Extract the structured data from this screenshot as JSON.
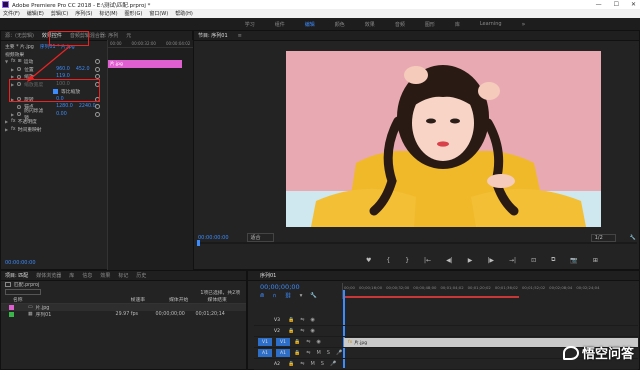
{
  "window": {
    "title": "Adobe Premiere Pro CC 2018 - E:\\测试\\匹配.prproj *",
    "minimize": "—",
    "maximize": "☐",
    "close": "✕"
  },
  "menu": [
    "文件(F)",
    "编辑(E)",
    "剪辑(C)",
    "序列(S)",
    "标记(M)",
    "图形(G)",
    "窗口(W)",
    "帮助(H)"
  ],
  "workspaces": {
    "items": [
      "学习",
      "组件",
      "编辑",
      "颜色",
      "效果",
      "音频",
      "图形",
      "库",
      "Learning"
    ],
    "active_index": 2,
    "more": "»"
  },
  "effect_panel": {
    "tabs": [
      "源：(无剪辑)",
      "效果控件",
      "音频剪辑混合器: 序列",
      "元"
    ],
    "active_tab": 1,
    "header_source": "主要 * 片.jpg",
    "header_seq": "序列01 * 片.jpg",
    "timecodes": [
      "00:00",
      "00:00:32:00",
      "00:00:04:02"
    ],
    "clip_label": "片.jpg",
    "video_effects_label": "视频效果",
    "motion_label": "运动",
    "position_label": "位置",
    "position_value_x": "960.0",
    "position_value_y": "452.0",
    "scale_label": "缩放",
    "scale_value": "119.0",
    "scale_width_label": "缩放宽度",
    "scale_width_value": "100.0",
    "uniform_scale_label": "等比缩放",
    "rotation_label": "旋转",
    "rotation_value": "0.0",
    "anchor_label": "锚点",
    "anchor_x": "1280.0",
    "anchor_y": "2240.0",
    "antiflicker_label": "防闪烁滤镜",
    "antiflicker_value": "0.00",
    "opacity_label": "不透明度",
    "time_remap_label": "时间重映射",
    "bottom_timecode": "00:00:00:00"
  },
  "program_panel": {
    "tab": "节目: 序列01",
    "timecode": "00:00:00:00",
    "fit": "适合",
    "quality": "1/2",
    "transport_icons": [
      "♥",
      "{",
      "}",
      "|←",
      "◀|",
      "▶",
      "|▶",
      "→|",
      "⊡",
      "⧉",
      "📷",
      "⊞"
    ]
  },
  "project_panel": {
    "tabs": [
      "项目: 匹配",
      "媒体浏览器",
      "库",
      "信息",
      "效果",
      "标记",
      "历史"
    ],
    "active_tab": 0,
    "project_file": "匹配.prproj",
    "item_count": "1项已选择，共2项",
    "columns": [
      "名称",
      "帧速率",
      "媒体开始",
      "媒体结束"
    ],
    "items": [
      {
        "name": "片.jpg",
        "color": "#e05fd0",
        "fps": "",
        "start": "",
        "end": ""
      },
      {
        "name": "序列01",
        "color": "#39b54a",
        "fps": "29.97 fps",
        "start": "00;00;00;00",
        "end": "00;01;20;14",
        "extra": "00;01;20;14"
      }
    ]
  },
  "timeline_panel": {
    "tab": "序列01",
    "timecode": "00;00;00;00",
    "ruler": [
      "00;00",
      "00;00;16;00",
      "00;00;32;00",
      "00;00;48;00",
      "00;01;04;02",
      "00;01;20;02",
      "00;01;36;02",
      "00;01;52;02",
      "00;02;08;04",
      "00;02;24;04"
    ],
    "tracks": [
      {
        "label": "V3",
        "on": false
      },
      {
        "label": "V2",
        "on": false
      },
      {
        "label": "V1",
        "on": true,
        "target": "V1"
      },
      {
        "label": "A1",
        "on": true,
        "target": "A1"
      },
      {
        "label": "A2",
        "on": false
      },
      {
        "label": "A3",
        "on": false
      }
    ],
    "clip_name": "片.jpg"
  },
  "watermark": "悟空问答",
  "colors": {
    "accent_blue": "#3c8cff",
    "highlight_red": "#e22222",
    "clip_pink": "#e05fd0",
    "video_bg": "#e8a9b2",
    "sweater": "#f0b92a"
  }
}
